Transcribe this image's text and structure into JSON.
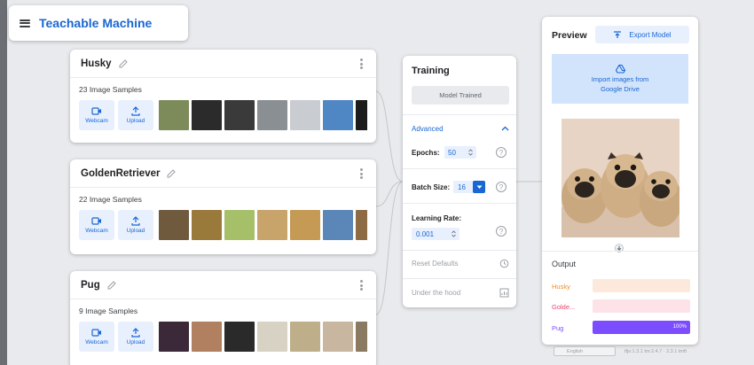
{
  "app": {
    "title": "Teachable Machine"
  },
  "classes": [
    {
      "name": "Husky",
      "sample_count": "23 Image Samples",
      "webcam_label": "Webcam",
      "upload_label": "Upload",
      "thumb_colors": [
        "#7d8a5a",
        "#2b2b2b",
        "#3a3a3a",
        "#8a8f94",
        "#c9ccd1",
        "#4f87c4",
        "#1c1c1c"
      ]
    },
    {
      "name": "GoldenRetriever",
      "sample_count": "22 Image Samples",
      "webcam_label": "Webcam",
      "upload_label": "Upload",
      "thumb_colors": [
        "#6f5a3e",
        "#9a7a3a",
        "#a6c06a",
        "#c8a36a",
        "#c49a55",
        "#5b86b8",
        "#8c6b45"
      ]
    },
    {
      "name": "Pug",
      "sample_count": "9 Image Samples",
      "webcam_label": "Webcam",
      "upload_label": "Upload",
      "thumb_colors": [
        "#3b2838",
        "#b08060",
        "#2a2a2a",
        "#d8d2c4",
        "#bfae8a",
        "#c8b6a0",
        "#8a7a62"
      ]
    }
  ],
  "training": {
    "title": "Training",
    "train_button": "Model Trained",
    "advanced_label": "Advanced",
    "epochs_label": "Epochs:",
    "epochs_value": "50",
    "batch_label": "Batch Size:",
    "batch_value": "16",
    "lr_label": "Learning Rate:",
    "lr_value": "0.001",
    "reset_label": "Reset Defaults",
    "hood_label": "Under the hood"
  },
  "preview": {
    "title": "Preview",
    "export_label": "Export Model",
    "import_line1": "Import images from",
    "import_line2": "Google Drive",
    "output_title": "Output",
    "outputs": [
      {
        "label": "Husky",
        "percent": 0,
        "color": "#f28b2a",
        "track": "#fde9dc",
        "pct_text": ""
      },
      {
        "label": "Golde...",
        "percent": 0,
        "color": "#e8456c",
        "track": "#fde3e8",
        "pct_text": ""
      },
      {
        "label": "Pug",
        "percent": 100,
        "color": "#7c4dff",
        "track": "#ece5ff",
        "pct_text": "100%"
      }
    ]
  },
  "footer": {
    "language": "English",
    "version": "tfjs:1.3.1 tm:2.4.7 · 2.3.1 tmft"
  }
}
